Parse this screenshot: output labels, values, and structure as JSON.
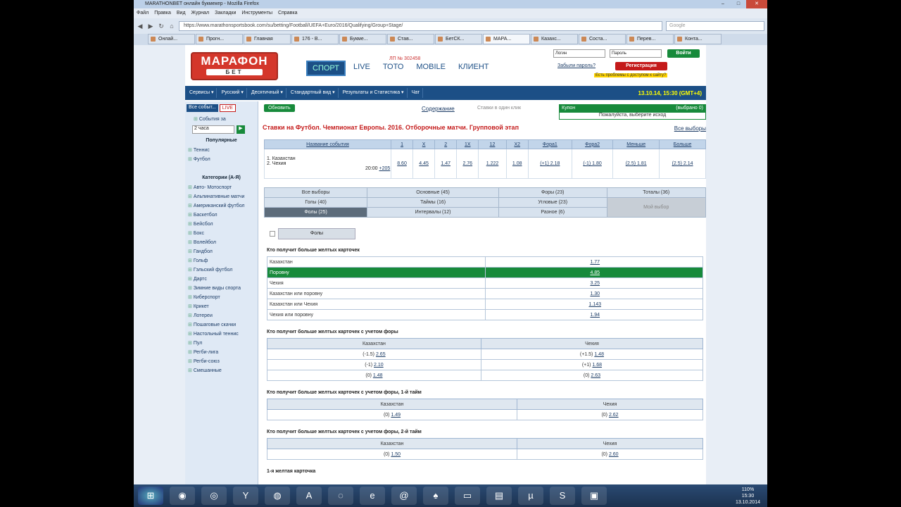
{
  "window": {
    "title": "MARATHONBET онлайн букмекер - Mozilla Firefox"
  },
  "menu": [
    "Файл",
    "Правка",
    "Вид",
    "Журнал",
    "Закладки",
    "Инструменты",
    "Справка"
  ],
  "url": "https://www.marathonsportsbook.com/su/betting/Football/UEFA+Euro/2016/Qualifying/Group+Stage/",
  "search_placeholder": "Google",
  "tabs": [
    "Онлай...",
    "Прогн...",
    "Главная",
    "176 - В...",
    "Букме...",
    "Став...",
    "БетСК...",
    "МАРА...",
    "Казахс...",
    "Соста...",
    "Перев...",
    "Конта..."
  ],
  "logo": {
    "line1": "МАРАФОН",
    "line2": "БЕТ"
  },
  "phone": "ЛП № 302458",
  "nav": [
    "СПОРТ",
    "LIVE",
    "ТОТО",
    "MOBILE",
    "КЛИЕНТ"
  ],
  "login": {
    "user_placeholder": "Логин",
    "pass_placeholder": "Пароль",
    "login_btn": "Войти",
    "forgot": "Забыли пароль?",
    "register": "Регистрация",
    "problem": "Есть проблемы с доступом к сайту?"
  },
  "toolbar": [
    "Сервисы ▾",
    "Русский ▾",
    "Десятичный ▾",
    "Стандартный вид ▾",
    "Результаты и Статистика ▾",
    "Чат"
  ],
  "datetime": "13.10.14, 15:30 (GMT+4)",
  "sidebar": {
    "all_events": "Все событ...",
    "live": "LIVE",
    "events_for": "События за",
    "hours": "2 часа",
    "popular": "Популярные",
    "popular_items": [
      "Теннис",
      "Футбол"
    ],
    "categories": "Категории (А-Я)",
    "items": [
      "Авто- Мотоспорт",
      "Альпинативные матчи",
      "Американский футбол",
      "Баскетбол",
      "Бейсбол",
      "Бокс",
      "Волейбол",
      "Гандбол",
      "Гольф",
      "Гэльский футбол",
      "Дартс",
      "Зимние виды спорта",
      "Киберспорт",
      "Крикет",
      "Лотереи",
      "Пошаговые скачки",
      "Настольный теннис",
      "Пул",
      "Регби-лига",
      "Регби-союз",
      "Смешанные"
    ]
  },
  "main": {
    "refresh": "Обновить",
    "content": "Содержание",
    "single_click": "Ставки в один клик",
    "coupon": "Купон",
    "coupon_sel": "(выбрано 0)",
    "coupon_msg": "Пожалуйста, выберите исход",
    "title": "Ставки на Футбол. Чемпионат Европы. 2016. Отборочные матчи. Групповой этап",
    "all_bets": "Все выборы"
  },
  "event": {
    "headers": [
      "Название события",
      "1",
      "X",
      "2",
      "1X",
      "12",
      "X2",
      "Фора1",
      "Фора2",
      "Меньше",
      "Больше"
    ],
    "team1": "1. Казахстан",
    "team2": "2. Чехия",
    "time": "20:00",
    "more": "+205",
    "odds": [
      "8.60",
      "4.45",
      "1.47",
      "2.76",
      "1.222",
      "1.08",
      "(+1) 2.18",
      "(-1) 1.80",
      "(2.5) 1.81",
      "(2.5) 2.14"
    ]
  },
  "markets": {
    "row1": [
      "Все выборы",
      "Основные (45)",
      "Форы (23)",
      "Тоталы (36)"
    ],
    "row2": [
      "Голы (40)",
      "Таймы (16)",
      "Угловые (23)"
    ],
    "row3": [
      "Фолы (25)",
      "Интервалы (12)",
      "Разное (6)"
    ],
    "mine": "Мой выбор"
  },
  "fouls_btn": "Фолы",
  "sec1": {
    "title": "Кто получит больше желтых карточек",
    "rows": [
      [
        "Казахстан",
        "1.77"
      ],
      [
        "Поровну",
        "4.85"
      ],
      [
        "Чехия",
        "3.25"
      ],
      [
        "Казахстан или поровну",
        "1.30"
      ],
      [
        "Казахстан или Чехия",
        "1.143"
      ],
      [
        "Чехия или поровну",
        "1.94"
      ]
    ]
  },
  "sec2": {
    "title": "Кто получит больше желтых карточек с учетом форы",
    "h": [
      "Казахстан",
      "Чехия"
    ],
    "rows": [
      [
        "(-1.5)",
        "2.65",
        "(+1.5)",
        "1.48"
      ],
      [
        "(-1)",
        "2.10",
        "(+1)",
        "1.68"
      ],
      [
        "(0)",
        "1.48",
        "(0)",
        "2.63"
      ]
    ]
  },
  "sec3": {
    "title": "Кто получит больше желтых карточек с учетом форы, 1-й тайм",
    "h": [
      "Казахстан",
      "Чехия"
    ],
    "rows": [
      [
        "(0)",
        "1.49",
        "(0)",
        "2.62"
      ]
    ]
  },
  "sec4": {
    "title": "Кто получит больше желтых карточек с учетом форы, 2-й тайм",
    "h": [
      "Казахстан",
      "Чехия"
    ],
    "rows": [
      [
        "(0)",
        "1.50",
        "(0)",
        "2.60"
      ]
    ]
  },
  "sec5": {
    "title": "1-я желтая карточка"
  },
  "clock": {
    "time": "15:30",
    "date": "13.10.2014"
  },
  "zoom": "110%"
}
